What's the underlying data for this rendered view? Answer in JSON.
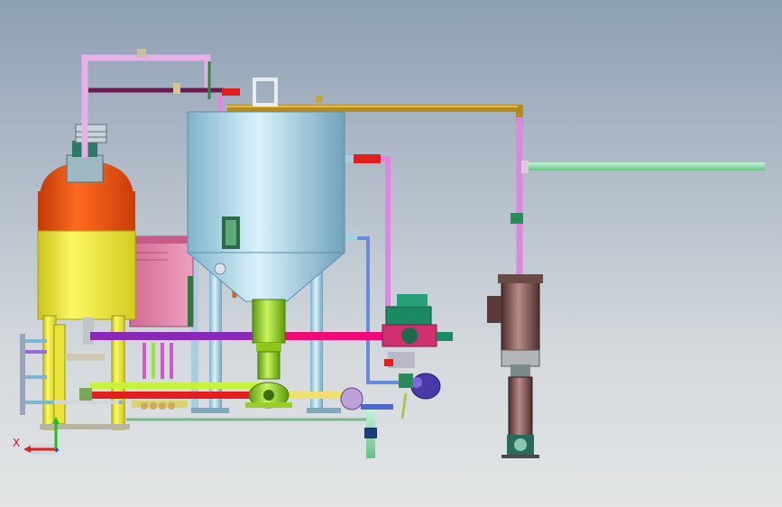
{
  "viewport": {
    "background_top": "#8d9fb4",
    "background_bottom": "#e3e5e6"
  },
  "triad": {
    "x_label": "X",
    "x_color": "#e02020",
    "y_color": "#20c020",
    "z_color": "#2040e0"
  },
  "colors": {
    "vessel_yellow": "#f6f23a",
    "vessel_orange": "#f24e0c",
    "tank_steel": "#9fd3ea",
    "panel_pink": "#e07ca4",
    "pump_green": "#9fe01e",
    "motor_brown": "#8a5a58",
    "pipe_violet": "#dd88dd",
    "pipe_gold": "#b58a1e",
    "pipe_magenta": "#f00a78",
    "pipe_red": "#e21e1e",
    "pipe_mint": "#90e8b0",
    "valve_teal": "#1a8a62",
    "pump_blue": "#4a3aa8"
  },
  "components": [
    {
      "id": "reactor-vessel",
      "icon": "vessel-icon"
    },
    {
      "id": "mixing-tank",
      "icon": "tank-icon"
    },
    {
      "id": "control-panel",
      "icon": "panel-icon"
    },
    {
      "id": "centrifugal-pump",
      "icon": "pump-icon"
    },
    {
      "id": "vertical-multistage-pump",
      "icon": "pump-icon"
    },
    {
      "id": "control-valve",
      "icon": "valve-icon"
    },
    {
      "id": "agitator-motor",
      "icon": "motor-icon"
    }
  ]
}
